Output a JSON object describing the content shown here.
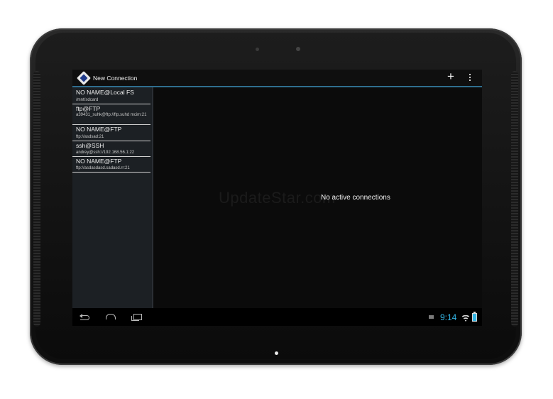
{
  "app": {
    "title": "New Connection"
  },
  "connections": [
    {
      "name": "NO NAME@Local FS",
      "detail": "/mnt/sdcard"
    },
    {
      "name": "ftp@FTP",
      "detail": "a39431_suhk@ftp://ftp.suhd mcim:21"
    },
    {
      "name": "NO NAME@FTP",
      "detail": "ftp://asdsad:21"
    },
    {
      "name": "ssh@SSH",
      "detail": "andrey@ssh://192.168.56.1:22"
    },
    {
      "name": "NO NAME@FTP",
      "detail": "ftp://asdasdasd.sadasd.rr:21"
    }
  ],
  "content": {
    "empty_message": "No active connections",
    "watermark": "UpdateStar.com"
  },
  "status_bar": {
    "time": "9:14"
  },
  "colors": {
    "accent": "#33b5e5",
    "actionbar_divider": "#2f6e8f",
    "sidebar_bg": "#1c2024"
  },
  "icons": {
    "app": "app-logo-icon",
    "add": "plus-icon",
    "overflow": "overflow-menu-icon",
    "back": "back-icon",
    "home": "home-icon",
    "recents": "recent-apps-icon",
    "notification": "notification-icon",
    "wifi": "wifi-icon",
    "battery": "battery-icon"
  }
}
